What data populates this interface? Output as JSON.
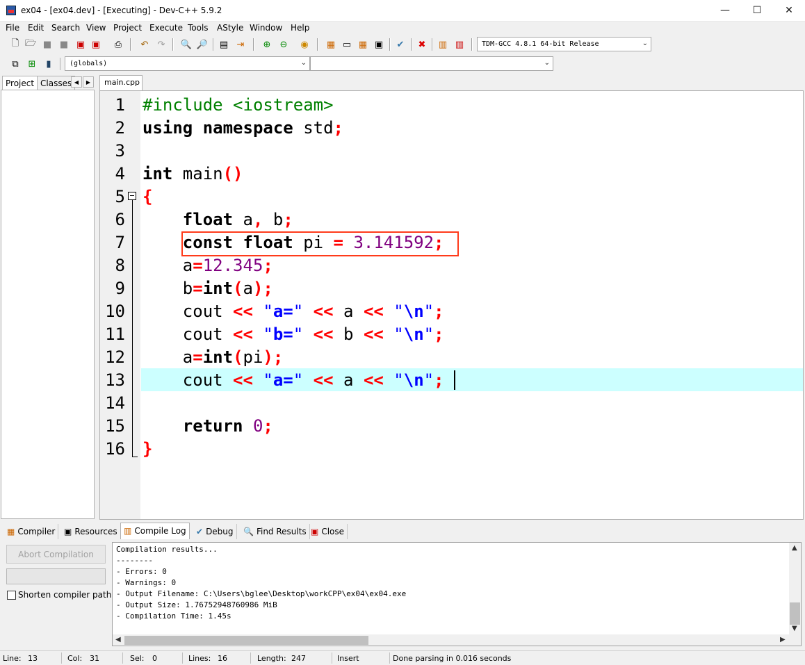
{
  "window": {
    "title": "ex04 - [ex04.dev] - [Executing] - Dev-C++ 5.9.2",
    "min_glyph": "—",
    "max_glyph": "☐",
    "close_glyph": "✕"
  },
  "menu": [
    "File",
    "Edit",
    "Search",
    "View",
    "Project",
    "Execute",
    "Tools",
    "AStyle",
    "Window",
    "Help"
  ],
  "toolbar": {
    "compiler_select": "TDM-GCC 4.8.1 64-bit Release",
    "scope_select": "(globals)",
    "function_select": ""
  },
  "left_panel": {
    "tabs": [
      "Project",
      "Classes"
    ],
    "scroll_left": "◀",
    "scroll_right": "▶"
  },
  "editor": {
    "file_tab": "main.cpp",
    "line_numbers": [
      "1",
      "2",
      "3",
      "4",
      "5",
      "6",
      "7",
      "8",
      "9",
      "10",
      "11",
      "12",
      "13",
      "14",
      "15",
      "16"
    ]
  },
  "bottom_tabs": [
    "Compiler",
    "Resources",
    "Compile Log",
    "Debug",
    "Find Results",
    "Close"
  ],
  "compile_panel": {
    "abort_label": "Abort Compilation",
    "shorten_label": "Shorten compiler paths",
    "shorten_checked": false,
    "log": [
      "Compilation results...",
      "--------",
      "- Errors: 0",
      "- Warnings: 0",
      "- Output Filename: C:\\Users\\bglee\\Desktop\\workCPP\\ex04\\ex04.exe",
      "- Output Size: 1.76752948760986 MiB",
      "- Compilation Time: 1.45s"
    ]
  },
  "statusbar": {
    "line_label": "Line:",
    "line_value": "13",
    "col_label": "Col:",
    "col_value": "31",
    "sel_label": "Sel:",
    "sel_value": "0",
    "lines_label": "Lines:",
    "lines_value": "16",
    "length_label": "Length:",
    "length_value": "247",
    "mode": "Insert",
    "message": "Done parsing in 0.016 seconds"
  },
  "colors": {
    "keyword": "#000000",
    "preprocessor": "#008000",
    "symbol": "#ff0000",
    "number": "#800080",
    "string": "#0000ff",
    "current_line": "#ccffff",
    "highlight_box": "#ff3a1a"
  }
}
